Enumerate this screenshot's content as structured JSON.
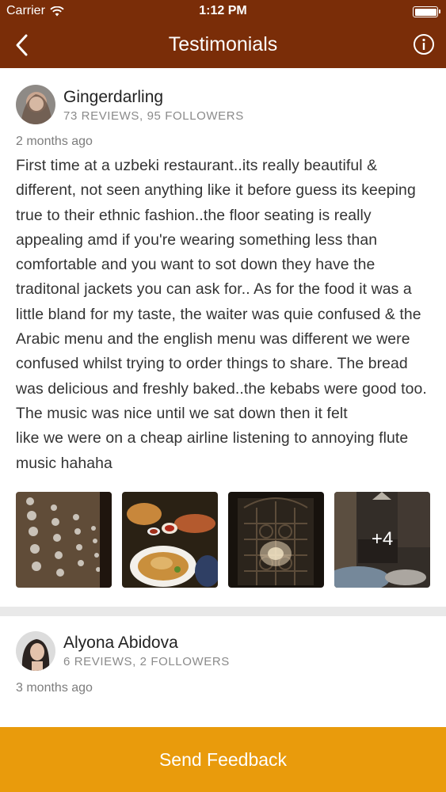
{
  "status_bar": {
    "carrier": "Carrier",
    "time": "1:12 PM"
  },
  "nav": {
    "title": "Testimonials",
    "back_icon": "chevron-left-icon",
    "info_icon": "info-icon"
  },
  "reviews": [
    {
      "name": "Gingerdarling",
      "stats": "73 REVIEWS, 95 FOLLOWERS",
      "date": "2 months ago",
      "text": "First time at a uzbeki restaurant..its really beautiful & different, not seen anything like it before guess its keeping true to their ethnic fashion..the floor seating is really appealing amd if you're wearing something less than comfortable and you want to sot down they have the traditonal jackets you can ask for.. As for the food it was a little bland for my taste, the waiter was quie confused & the Arabic menu and the english menu was different we were confused whilst trying to order things to share. The bread was delicious and freshly baked..the kebabs were good too.  The music was nice until we sat down then it felt\nlike we were on a cheap airline listening to annoying flute music hahaha",
      "more_photos": "+4"
    },
    {
      "name": "Alyona Abidova",
      "stats": "6 REVIEWS, 2 FOLLOWERS",
      "date": "3 months ago"
    }
  ],
  "footer": {
    "send_feedback": "Send Feedback"
  },
  "colors": {
    "header": "#7a2d08",
    "accent": "#e99b0c",
    "divider": "#e9e9e9"
  }
}
